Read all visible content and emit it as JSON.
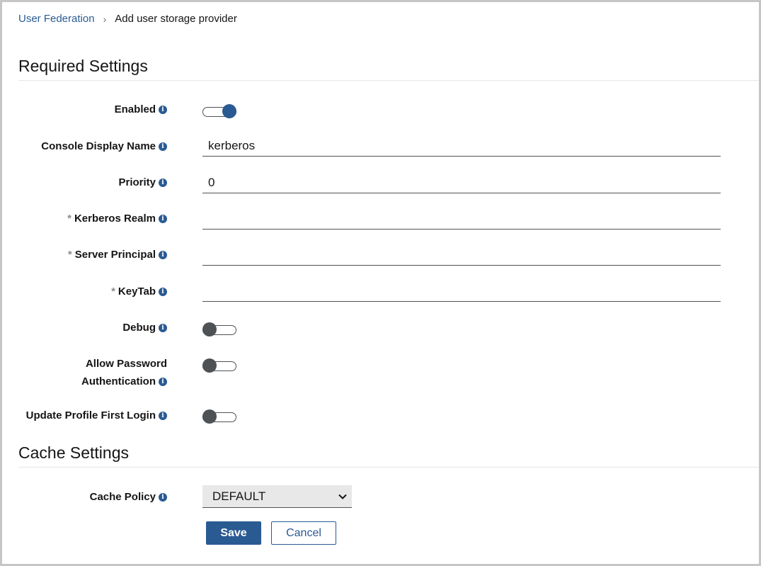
{
  "breadcrumb": {
    "parent": "User Federation",
    "separator": "›",
    "current": "Add user storage provider"
  },
  "sections": {
    "required": "Required Settings",
    "cache": "Cache Settings"
  },
  "fields": {
    "enabled": {
      "label": "Enabled",
      "value": true
    },
    "console_display_name": {
      "label": "Console Display Name",
      "value": "kerberos"
    },
    "priority": {
      "label": "Priority",
      "value": "0"
    },
    "kerberos_realm": {
      "label": "Kerberos Realm",
      "required": true,
      "value": ""
    },
    "server_principal": {
      "label": "Server Principal",
      "required": true,
      "value": ""
    },
    "keytab": {
      "label": "KeyTab",
      "required": true,
      "value": ""
    },
    "debug": {
      "label": "Debug",
      "value": false
    },
    "allow_password_auth": {
      "label_line1": "Allow Password",
      "label_line2": "Authentication",
      "value": false
    },
    "update_profile_first_login": {
      "label": "Update Profile First Login",
      "value": false
    },
    "cache_policy": {
      "label": "Cache Policy",
      "value": "DEFAULT"
    }
  },
  "required_marker": "*",
  "info_glyph": "i",
  "buttons": {
    "save": "Save",
    "cancel": "Cancel"
  },
  "colors": {
    "accent": "#2a5a92",
    "toggle_off": "#4f5255",
    "select_bg": "#e8e8e8"
  },
  "icons": {
    "info": "info-icon",
    "chevron": "chevron-down-icon",
    "separator": "chevron-right-icon"
  }
}
